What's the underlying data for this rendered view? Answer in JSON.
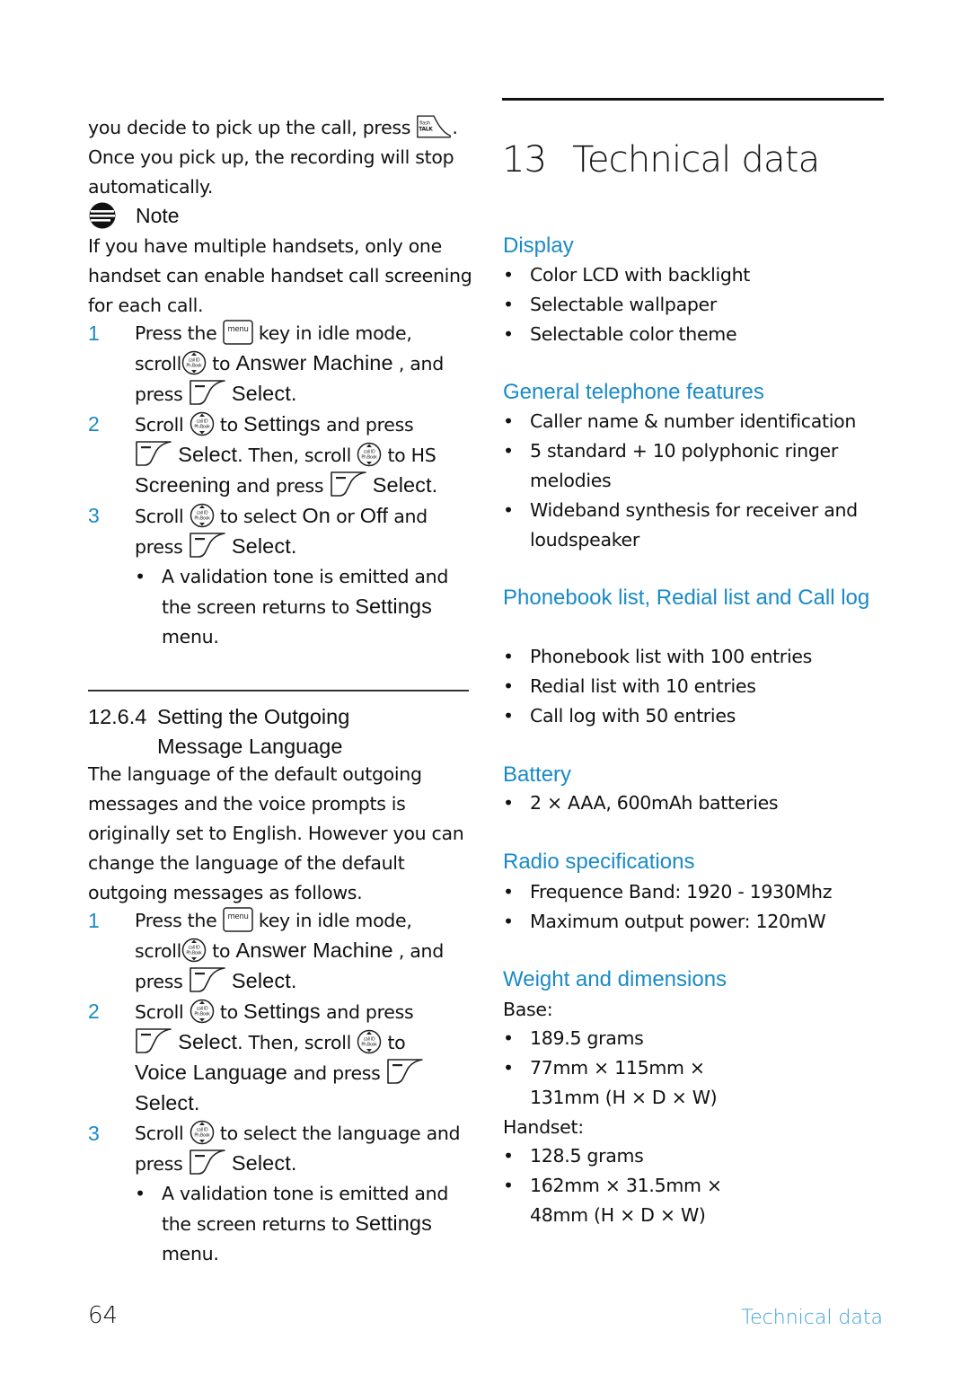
{
  "page": {
    "number": "64",
    "footer_title": "Technical data",
    "accent_color": "#1a8ac6"
  },
  "left": {
    "intro": {
      "line1": "you decide to pick up the call, press",
      "line1_icon": "flash-talk-key-icon",
      "line1_end": ".",
      "rest": "Once you pick up, the recording will stop automatically."
    },
    "note": {
      "label": "Note",
      "icon": "note-icon",
      "text": "If you have multiple handsets, only one handset can enable handset call screening for each call."
    },
    "steps_a": [
      {
        "num": "1",
        "parts": {
          "a": "Press the",
          "b": "key in idle mode,",
          "c": "scroll",
          "d": "to",
          "e": "Answer Machine",
          "f": ", and",
          "g": "press",
          "h": "Select",
          "i": "."
        }
      },
      {
        "num": "2",
        "parts": {
          "a": "Scroll",
          "b": "to",
          "c": "Settings",
          "d": "and press",
          "e": "Select",
          "f": ". Then, scroll",
          "g": "to HS",
          "h": "Screening",
          "i": "and press",
          "j": "Select",
          "k": "."
        }
      },
      {
        "num": "3",
        "parts": {
          "a": "Scroll",
          "b": "to select",
          "c": "On",
          "d": "or",
          "e": "Off",
          "f": "and",
          "g": "press",
          "h": "Select",
          "i": "."
        },
        "sub": {
          "a": "A validation tone is emitted and the screen returns to",
          "b": "Settings",
          "c": "menu."
        }
      }
    ],
    "section": {
      "number": "12.6.4",
      "title_line1": "Setting the Outgoing",
      "title_line2": "Message Language",
      "intro": "The language of the default outgoing messages and the voice prompts is originally set to English. However you can change the language of the default outgoing messages as follows."
    },
    "steps_b": [
      {
        "num": "1",
        "parts": {
          "a": "Press the",
          "b": "key in idle mode,",
          "c": "scroll",
          "d": "to",
          "e": "Answer Machine",
          "f": ", and",
          "g": "press",
          "h": "Select",
          "i": "."
        }
      },
      {
        "num": "2",
        "parts": {
          "a": "Scroll",
          "b": "to",
          "c": "Settings",
          "d": "and press",
          "e": "Select",
          "f": ". Then, scroll",
          "g": "to",
          "h": "Voice Language",
          "i": "and press",
          "j": "Select",
          "k": "."
        }
      },
      {
        "num": "3",
        "parts": {
          "a": "Scroll",
          "b": "to select the language and",
          "c": "press",
          "d": "Select",
          "e": "."
        },
        "sub": {
          "a": "A validation tone is emitted and the screen returns to",
          "b": "Settings",
          "c": "menu."
        }
      }
    ],
    "icons": {
      "menu_key": "menu",
      "scroll_key_top": "call ID",
      "scroll_key_bottom": "Ph.Book",
      "flash_top": "flash",
      "flash_bottom": "TALK"
    }
  },
  "right": {
    "chapter": {
      "number": "13",
      "title": "Technical data"
    },
    "sections": [
      {
        "heading": "Display",
        "items": [
          "Color LCD with backlight",
          "Selectable wallpaper",
          "Selectable color theme"
        ]
      },
      {
        "heading": "General telephone features",
        "items": [
          "Caller name & number identification",
          "5 standard + 10 polyphonic ringer melodies",
          "Wideband synthesis for receiver and loudspeaker"
        ]
      },
      {
        "heading": "Phonebook list, Redial list and Call log",
        "items": [
          "Phonebook list with 100 entries",
          "Redial list with 10 entries",
          "Call log with 50 entries"
        ]
      },
      {
        "heading": "Battery",
        "items": [
          "2 × AAA, 600mAh batteries"
        ]
      },
      {
        "heading": "Radio specifications",
        "items": [
          "Frequence Band: 1920 - 1930Mhz",
          "Maximum output power: 120mW"
        ]
      },
      {
        "heading": "Weight and dimensions",
        "base_label": "Base:",
        "base_items": [
          "189.5 grams",
          "77mm × 115mm × 131mm (H × D × W)"
        ],
        "handset_label": "Handset:",
        "handset_items": [
          "128.5 grams",
          "162mm × 31.5mm × 48mm (H × D × W)"
        ]
      }
    ]
  }
}
